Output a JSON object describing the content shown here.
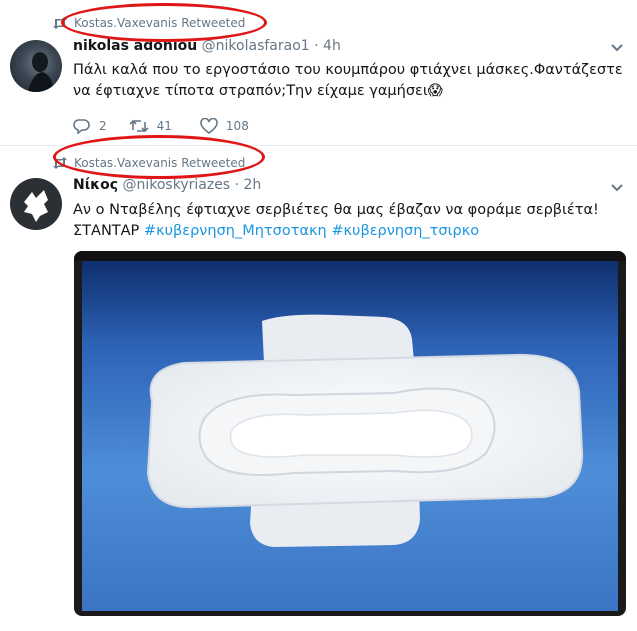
{
  "tweets": [
    {
      "retweeted_by": "Kostas.Vaxevanis Retweeted",
      "name": "nikolas adoniou",
      "handle": "@nikolasfarao1",
      "time": "· 4h",
      "text": "Πάλι καλά που το εργοστάσιο του κουμπάρου φτιάχνει μάσκες.Φαντάζεστε να έφτιαχνε τίποτα στραπόν;Την είχαμε γαμήσει😱",
      "replies": "2",
      "retweets": "41",
      "likes": "108"
    },
    {
      "retweeted_by": "Kostas.Vaxevanis Retweeted",
      "name": "Νίκος",
      "handle": "@nikoskyriazes",
      "time": "· 2h",
      "text_line1": "Αν ο Νταβέλης έφτιαχνε  σερβιέτες θα μας έβαζαν να φοράμε σερβιέτα!",
      "text_line2_prefix": "ΣΤΑΝΤΑΡ",
      "hashtag1": "#κυβερνηση_Μητσοτακη",
      "hashtag2": "#κυβερνηση_τσιρκο"
    }
  ],
  "colors": {
    "link": "#1b95e0",
    "secondary_text": "#657786",
    "annotation": "#e01616"
  },
  "icons": [
    "retweet-icon",
    "reply-icon",
    "like-icon",
    "chevron-down-icon",
    "avatar"
  ]
}
